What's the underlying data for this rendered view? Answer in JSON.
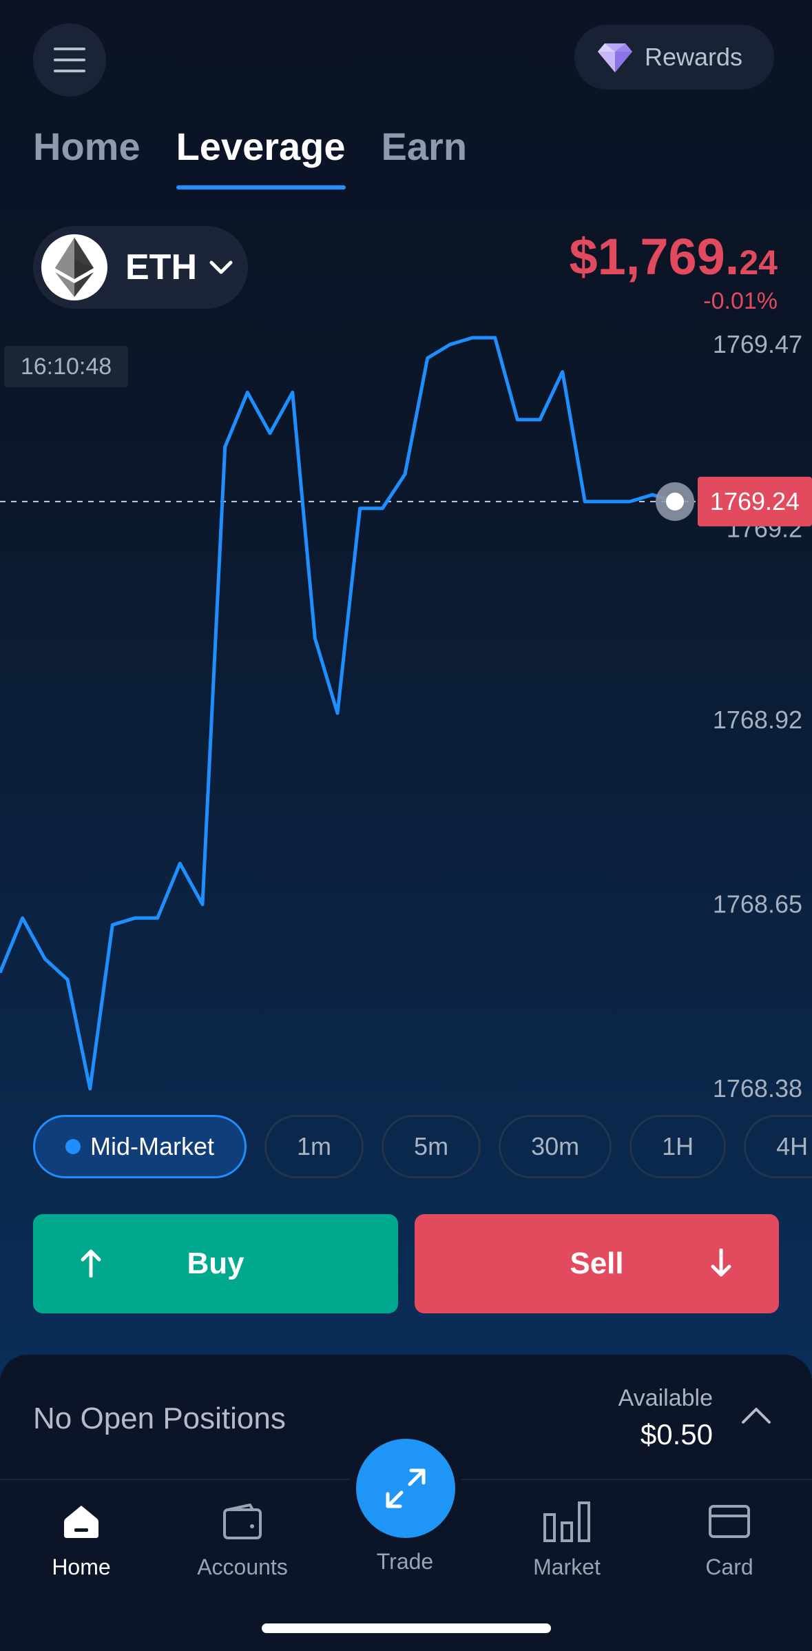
{
  "header": {
    "rewards_label": "Rewards"
  },
  "tabs": [
    {
      "label": "Home",
      "active": false
    },
    {
      "label": "Leverage",
      "active": true
    },
    {
      "label": "Earn",
      "active": false
    }
  ],
  "asset": {
    "symbol": "ETH",
    "price_main": "$1,769.",
    "price_cents": "24",
    "change": "-0.01%"
  },
  "chart": {
    "timestamp": "16:10:48",
    "current_value_label": "1769.24",
    "y_labels": [
      "1769.47",
      "1769.2",
      "1768.92",
      "1768.65",
      "1768.38"
    ],
    "line_color": "#1f8fff",
    "current_badge_color": "#e24a5d"
  },
  "chart_data": {
    "type": "line",
    "series": [
      {
        "values": [
          1768.55,
          1768.63,
          1768.57,
          1768.54,
          1768.38,
          1768.62,
          1768.63,
          1768.63,
          1768.71,
          1768.65,
          1769.32,
          1769.4,
          1769.34,
          1769.4,
          1769.04,
          1768.93,
          1769.23,
          1769.23,
          1769.28,
          1769.45,
          1769.47,
          1769.48,
          1769.48,
          1769.36,
          1769.36,
          1769.43,
          1769.24,
          1769.24,
          1769.24,
          1769.25,
          1769.24
        ]
      }
    ],
    "y_ticks": [
      1769.47,
      1769.2,
      1768.92,
      1768.65,
      1768.38
    ],
    "ylim": [
      1768.38,
      1769.47
    ],
    "current": 1769.24,
    "grid": false
  },
  "ranges": [
    {
      "label": "Mid-Market",
      "active": true
    },
    {
      "label": "1m",
      "active": false
    },
    {
      "label": "5m",
      "active": false
    },
    {
      "label": "30m",
      "active": false
    },
    {
      "label": "1H",
      "active": false
    },
    {
      "label": "4H",
      "active": false
    }
  ],
  "actions": {
    "buy_label": "Buy",
    "sell_label": "Sell",
    "buy_color": "#00a88e",
    "sell_color": "#e24a5d"
  },
  "positions": {
    "status": "No Open Positions",
    "available_label": "Available",
    "available_value": "$0.50"
  },
  "bottom_nav": [
    {
      "label": "Home",
      "icon": "home-icon",
      "active": true
    },
    {
      "label": "Accounts",
      "icon": "wallet-icon",
      "active": false
    },
    {
      "label": "Trade",
      "icon": "swap-arrows-icon",
      "active": false
    },
    {
      "label": "Market",
      "icon": "bar-chart-icon",
      "active": false
    },
    {
      "label": "Card",
      "icon": "credit-card-icon",
      "active": false
    }
  ]
}
